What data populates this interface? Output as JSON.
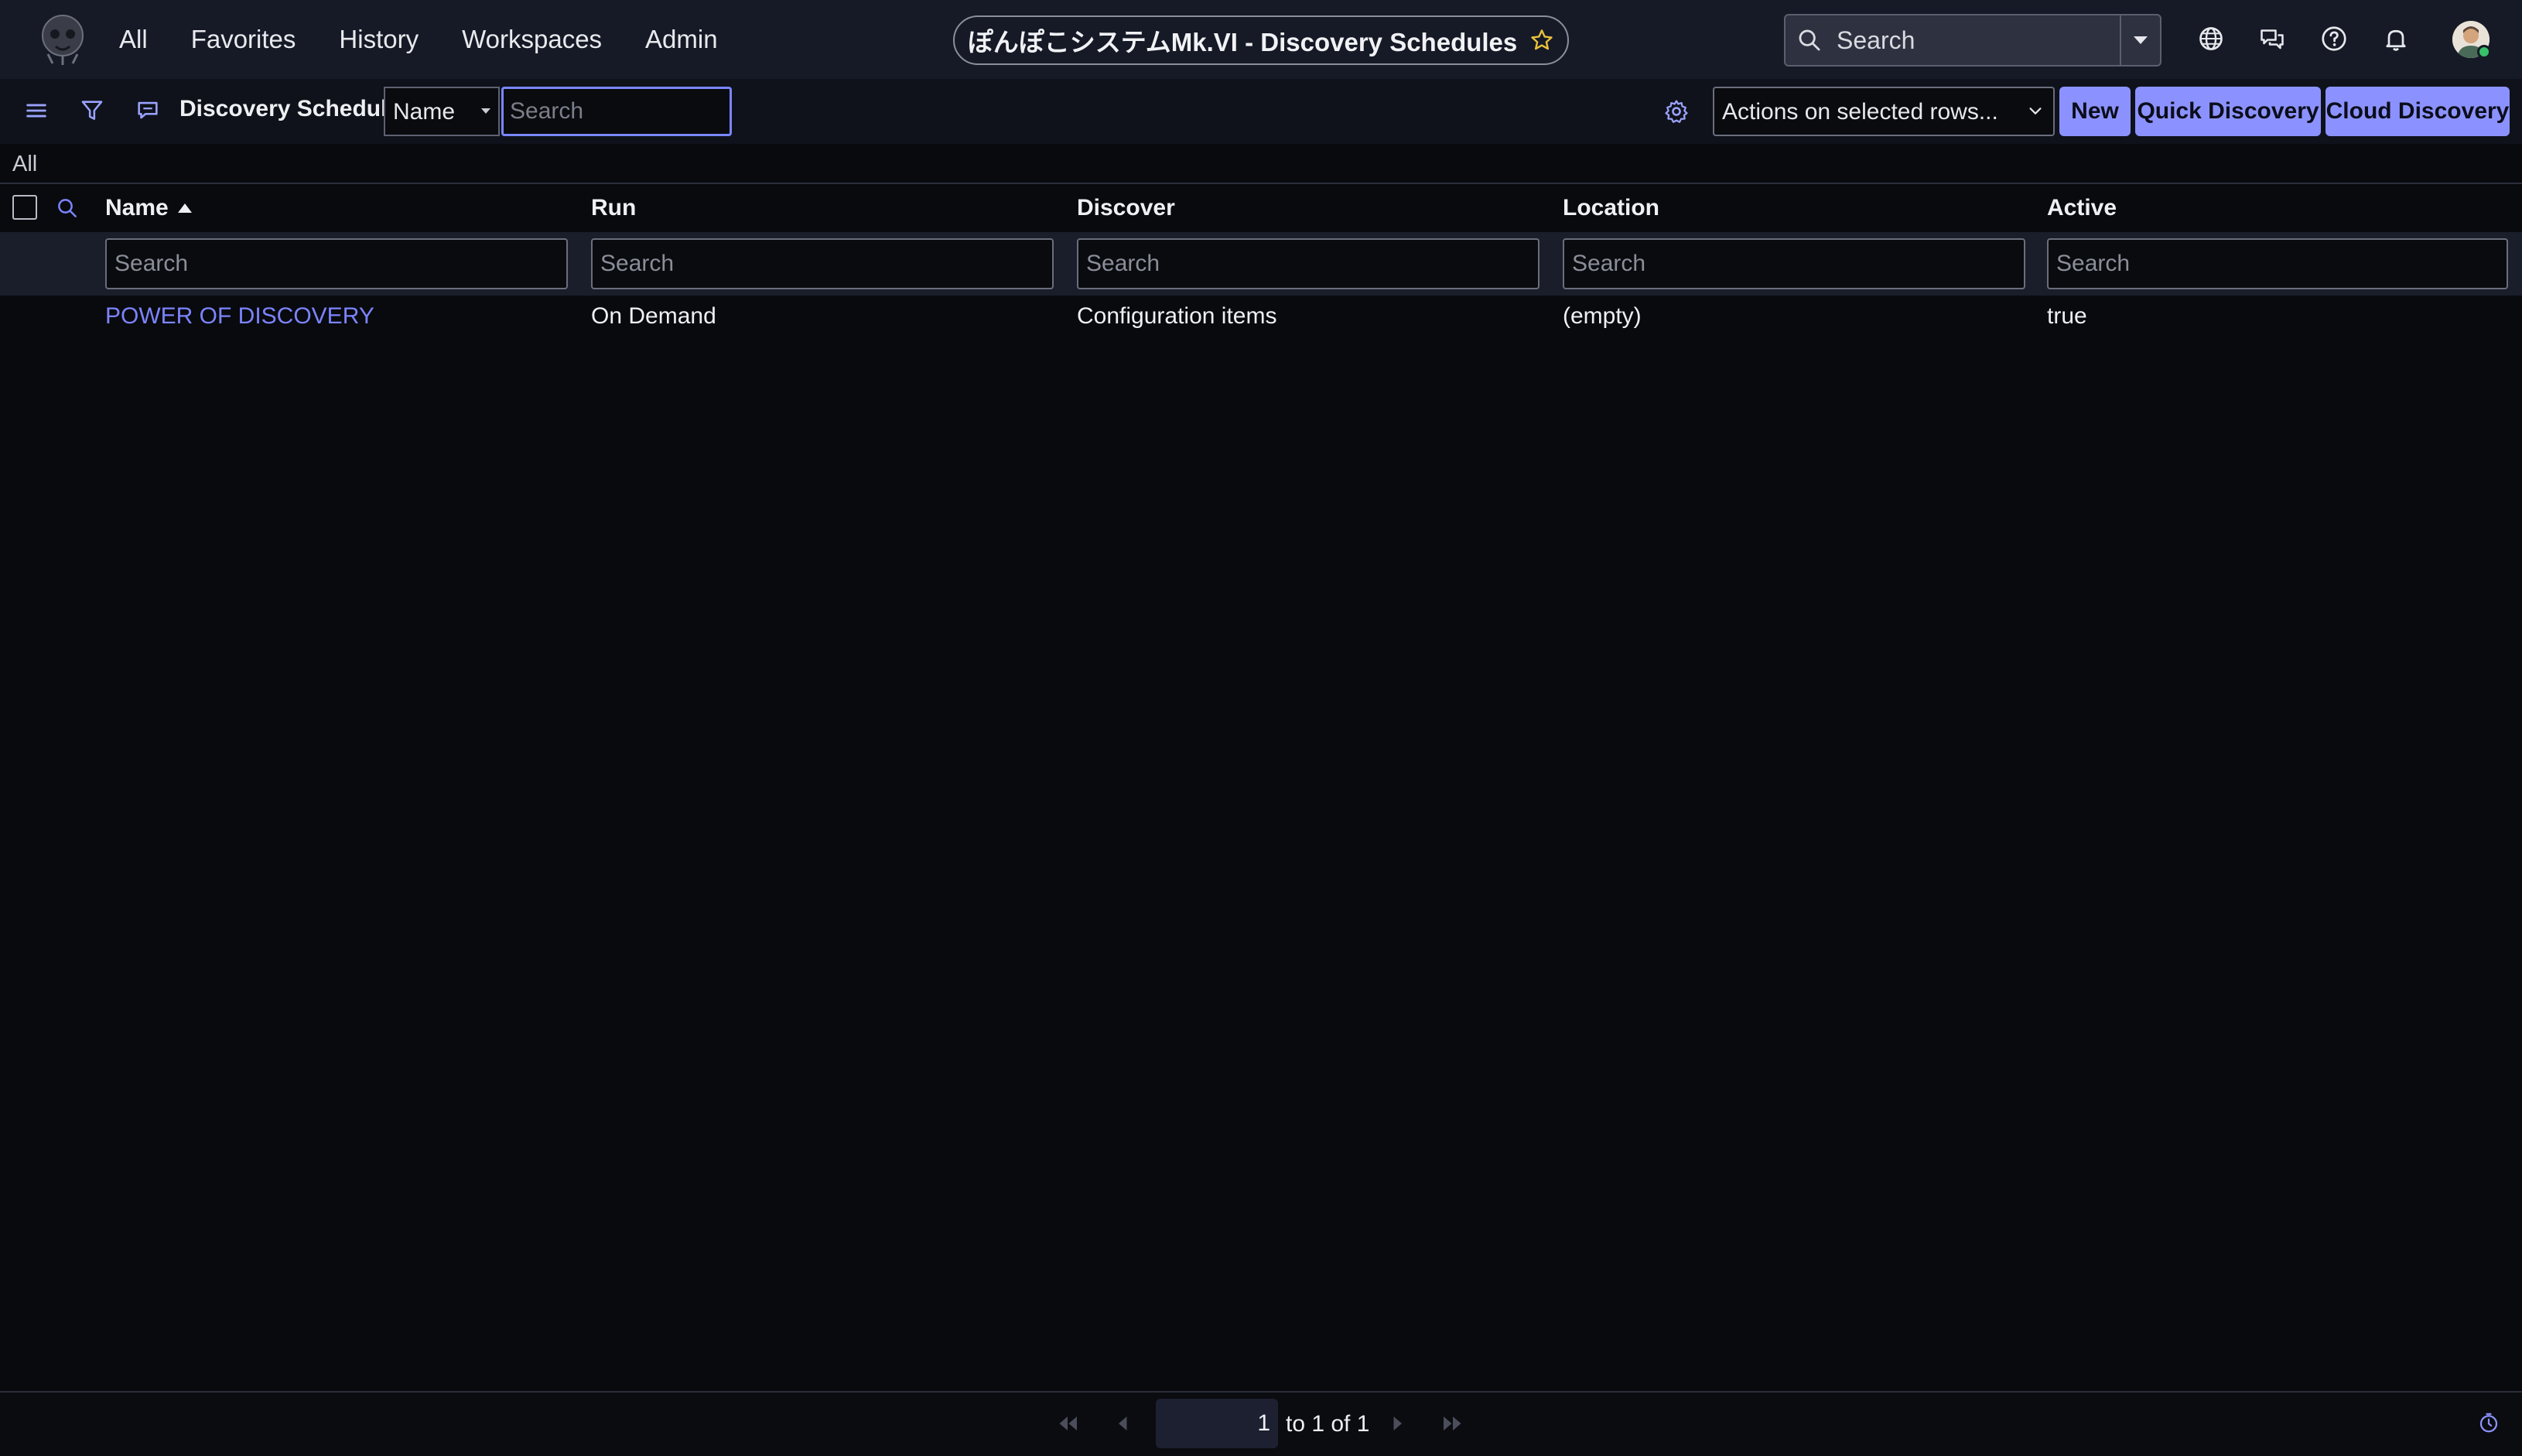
{
  "nav": {
    "items": [
      "All",
      "Favorites",
      "History",
      "Workspaces",
      "Admin"
    ],
    "title": "ぽんぽこシステムMk.VI - Discovery Schedules",
    "search_placeholder": "Search"
  },
  "toolbar": {
    "list_title": "Discovery Schedules",
    "field_select": "Name",
    "search_placeholder": "Search",
    "actions_select": "Actions on selected rows...",
    "buttons": {
      "new": "New",
      "quick_discovery": "Quick Discovery",
      "cloud_discovery": "Cloud Discovery"
    }
  },
  "breadcrumb": "All",
  "table": {
    "columns": [
      "Name",
      "Run",
      "Discover",
      "Location",
      "Active"
    ],
    "sort_column": "Name",
    "sort_direction": "ascending",
    "filter_placeholder": "Search",
    "rows": [
      {
        "name": "POWER OF DISCOVERY",
        "run": "On Demand",
        "discover": "Configuration items",
        "location": "(empty)",
        "active": "true"
      }
    ]
  },
  "pagination": {
    "current_page": "1",
    "range_text": "to 1 of 1"
  },
  "colors": {
    "accent": "#8b92ff",
    "link": "#7b84ff",
    "topbar_bg": "#161a26",
    "page_bg": "#090a0d"
  },
  "icons": [
    "menu-icon",
    "filter-icon",
    "comment-icon",
    "search-icon",
    "globe-icon",
    "chat-icon",
    "help-icon",
    "bell-icon",
    "gear-icon",
    "star-icon",
    "timer-icon"
  ]
}
